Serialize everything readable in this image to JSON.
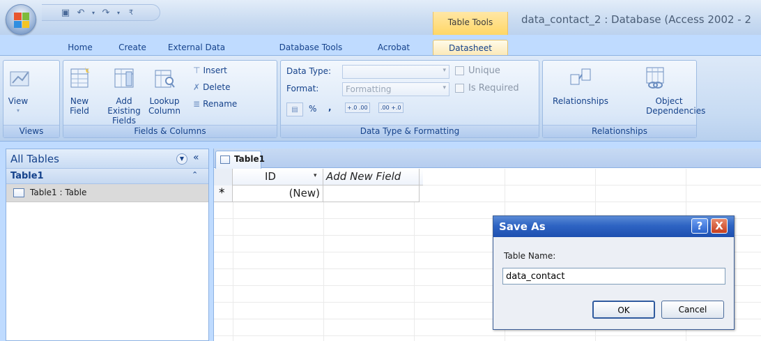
{
  "window": {
    "title": "data_contact_2 : Database (Access 2002 - 2",
    "contextual_group": "Table Tools"
  },
  "tabs": [
    {
      "label": "Home"
    },
    {
      "label": "Create"
    },
    {
      "label": "External Data"
    },
    {
      "label": "Database Tools"
    },
    {
      "label": "Acrobat"
    },
    {
      "label": "Datasheet",
      "active": true
    }
  ],
  "ribbon": {
    "views": {
      "label": "Views",
      "view_button": "View"
    },
    "fields_columns": {
      "label": "Fields & Columns",
      "new_field": "New Field",
      "add_existing_fields": "Add Existing Fields",
      "lookup_column": "Lookup Column",
      "insert": "Insert",
      "delete": "Delete",
      "rename": "Rename"
    },
    "data_type_formatting": {
      "label": "Data Type & Formatting",
      "data_type_label": "Data Type:",
      "data_type_value": "",
      "format_label": "Format:",
      "format_value": "Formatting",
      "unique": "Unique",
      "is_required": "Is Required",
      "percent": "%",
      "comma": ",",
      "increase_decimals": "+.0 .00",
      "decrease_decimals": ".00 +.0"
    },
    "relationships": {
      "label": "Relationships",
      "relationships_button": "Relationships",
      "object_dependencies": "Object Dependencies"
    }
  },
  "nav": {
    "header": "All Tables",
    "group": "Table1",
    "items": [
      {
        "label": "Table1 : Table"
      }
    ]
  },
  "doc": {
    "tab": "Table1",
    "columns": [
      {
        "label": "ID"
      },
      {
        "label": "Add New Field"
      }
    ],
    "new_row": {
      "marker": "*",
      "id": "(New)"
    }
  },
  "dialog": {
    "title": "Save As",
    "help": "?",
    "close": "X",
    "field_label": "Table Name:",
    "field_value": "data_contact",
    "ok": "OK",
    "cancel": "Cancel"
  },
  "colors": {
    "ribbon_text": "#15428b",
    "contextual_tab": "#ffd765",
    "dialog_title_bar": "#2e64c3",
    "close_button": "#c63d1d"
  }
}
